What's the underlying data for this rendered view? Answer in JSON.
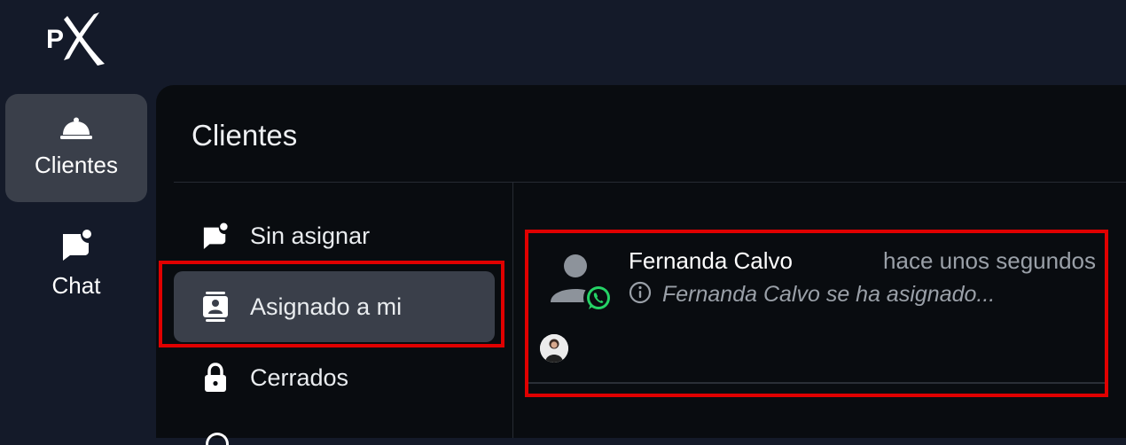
{
  "app": {
    "logo_text": "PX"
  },
  "rail": {
    "items": [
      {
        "label": "Clientes",
        "icon": "service-bell-icon",
        "active": true
      },
      {
        "label": "Chat",
        "icon": "chat-bubble-icon",
        "active": false
      }
    ]
  },
  "panel": {
    "title": "Clientes",
    "nav": [
      {
        "label": "Sin asignar",
        "icon": "chat-unread-icon",
        "active": false
      },
      {
        "label": "Asignado a mi",
        "icon": "contact-card-icon",
        "active": true
      },
      {
        "label": "Cerrados",
        "icon": "lock-icon",
        "active": false
      }
    ]
  },
  "conversation": {
    "name": "Fernanda Calvo",
    "time": "hace unos segundos",
    "preview": "Fernanda Calvo se ha asignado...",
    "channel_icon": "whatsapp-icon"
  },
  "colors": {
    "background": "#141a29",
    "panel": "#090c10",
    "active_item": "#3a3f4a",
    "highlight": "#e00000",
    "whatsapp": "#25d366"
  }
}
